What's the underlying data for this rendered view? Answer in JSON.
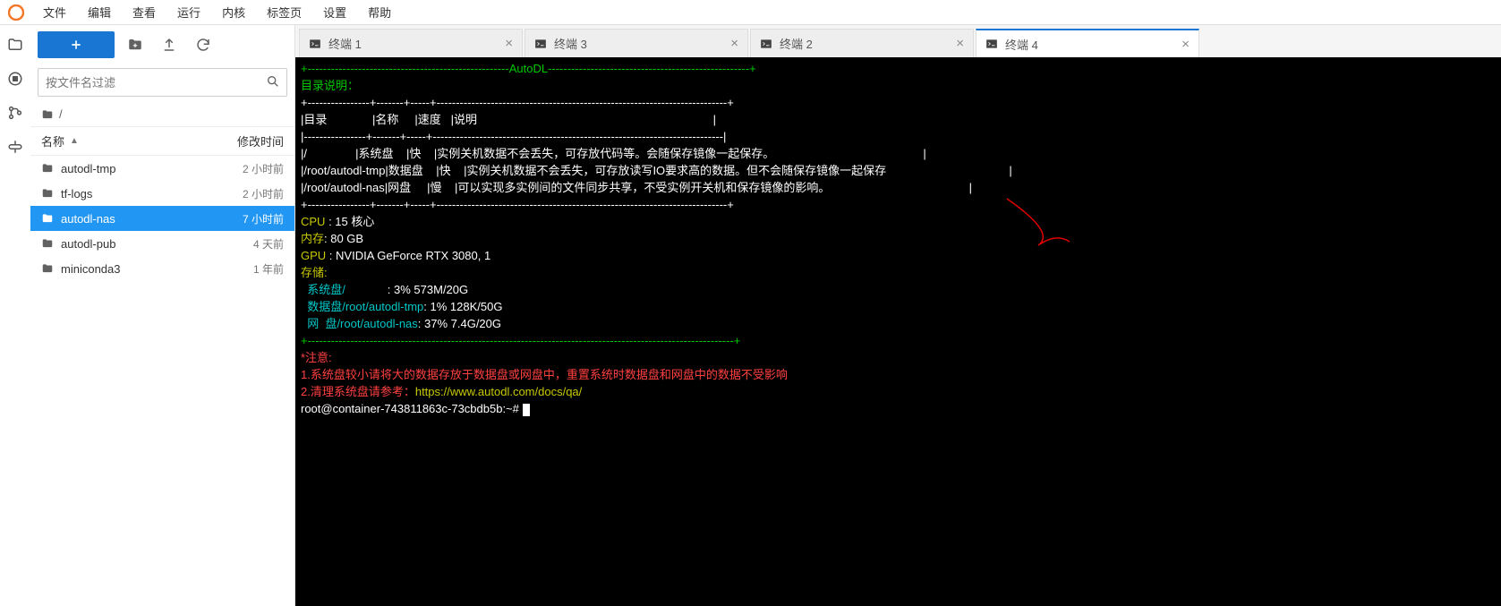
{
  "menu": [
    "文件",
    "编辑",
    "查看",
    "运行",
    "内核",
    "标签页",
    "设置",
    "帮助"
  ],
  "sidebar": {
    "filter_placeholder": "按文件名过滤",
    "breadcrumb": "/",
    "col_name": "名称",
    "col_mod": "修改时间",
    "rows": [
      {
        "name": "autodl-tmp",
        "mod": "2 小时前",
        "sel": false
      },
      {
        "name": "tf-logs",
        "mod": "2 小时前",
        "sel": false
      },
      {
        "name": "autodl-nas",
        "mod": "7 小时前",
        "sel": true
      },
      {
        "name": "autodl-pub",
        "mod": "4 天前",
        "sel": false
      },
      {
        "name": "miniconda3",
        "mod": "1 年前",
        "sel": false
      }
    ]
  },
  "tabs": [
    {
      "label": "终端 1",
      "active": false
    },
    {
      "label": "终端 3",
      "active": false
    },
    {
      "label": "终端 2",
      "active": false
    },
    {
      "label": "终端 4",
      "active": true
    }
  ],
  "term": {
    "banner": "AutoDL",
    "dir_title": "目录说明：",
    "th": [
      "目录",
      "名称",
      "速度",
      "说明"
    ],
    "td": [
      [
        "/",
        "系统盘",
        "快",
        "实例关机数据不会丢失，可存放代码等。会随保存镜像一起保存。"
      ],
      [
        "/root/autodl-tmp",
        "数据盘",
        "快",
        "实例关机数据不会丢失，可存放读写IO要求高的数据。但不会随保存镜像一起保存"
      ],
      [
        "/root/autodl-nas",
        "网盘",
        "慢",
        "可以实现多实例间的文件同步共享，不受实例开关机和保存镜像的影响。"
      ]
    ],
    "cpu_l": "CPU ",
    "cpu_v": ": 15 核心",
    "mem_l": "内存",
    "mem_v": ": 80 GB",
    "gpu_l": "GPU ",
    "gpu_v": ": NVIDIA GeForce RTX 3080, 1",
    "stor_l": "存储:",
    "s1_l": "  系统盘/",
    "s1_v": "             : 3% 573M/20G",
    "s2_l": "  数据盘/root/autodl-tmp",
    "s2_v": ": 1% 128K/50G",
    "s3_l": "  网  盘/root/autodl-nas",
    "s3_v": ": 37% 7.4G/20G",
    "note_t": "*注意: ",
    "note1": "1.系统盘较小请将大的数据存放于数据盘或网盘中，重置系统时数据盘和网盘中的数据不受影响",
    "note2a": "2.清理系统盘请参考：",
    "note2b": "https://www.autodl.com/docs/qa/",
    "prompt": "root@container-743811863c-73cbdb5b:~# "
  }
}
